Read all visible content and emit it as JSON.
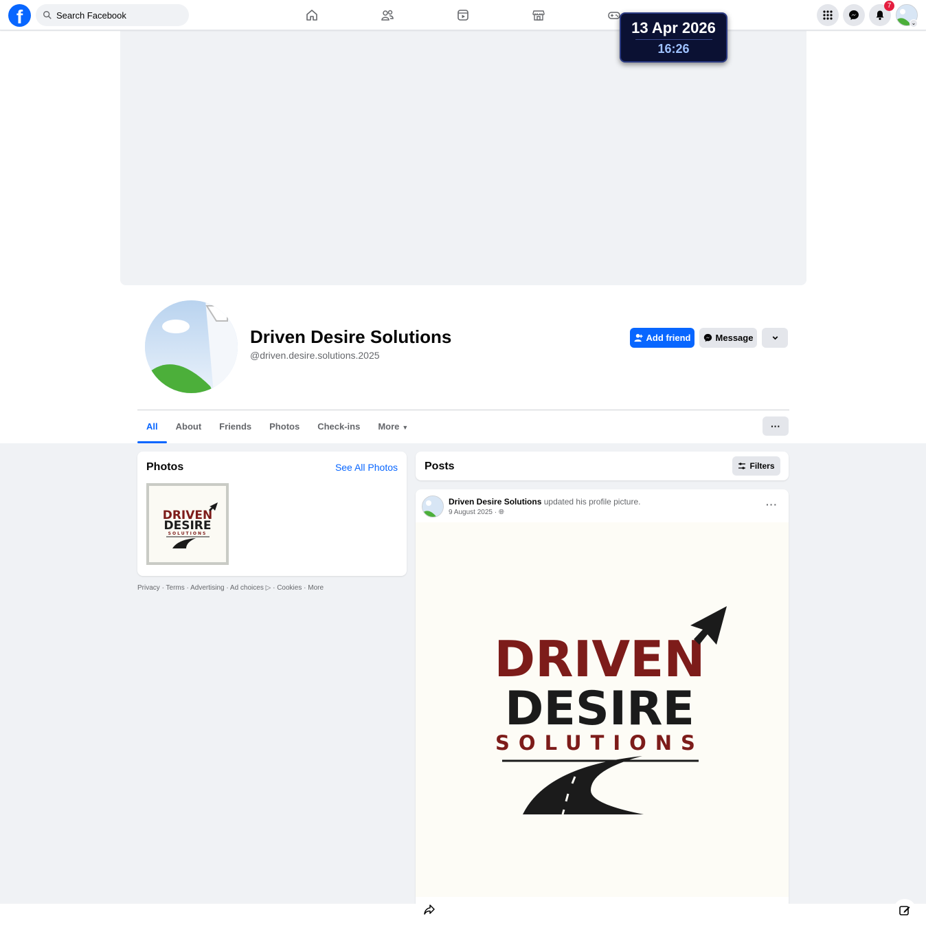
{
  "nav": {
    "search_placeholder": "Search Facebook",
    "notifications_count": "7",
    "brand_color": "#0866ff"
  },
  "overlay": {
    "date": "13 Apr 2026",
    "time": "16:26"
  },
  "profile": {
    "name": "Driven Desire Solutions",
    "handle": "@driven.desire.solutions.2025",
    "add_friend_label": "Add friend",
    "message_label": "Message"
  },
  "tabs": [
    {
      "label": "All",
      "active": true
    },
    {
      "label": "About"
    },
    {
      "label": "Friends"
    },
    {
      "label": "Photos"
    },
    {
      "label": "Check-ins"
    },
    {
      "label": "More"
    }
  ],
  "photos": {
    "title": "Photos",
    "see_all": "See All Photos"
  },
  "footer": {
    "privacy": "Privacy",
    "terms": "Terms",
    "advertising": "Advertising",
    "ad_choices": "Ad choices",
    "cookies": "Cookies",
    "more": "More",
    "sep": " · "
  },
  "posts": {
    "title": "Posts",
    "filters_label": "Filters",
    "items": [
      {
        "author": "Driven Desire Solutions",
        "action": "updated his profile picture.",
        "date": "9 August 2025",
        "logo": {
          "line1": "DRIVEN",
          "line2": "DESIRE",
          "line3": "SOLUTIONS"
        }
      }
    ]
  },
  "thumb_logo": {
    "line1": "DRIVEN",
    "line2": "DESIRE",
    "line3": "SOLUTIONS"
  },
  "colors": {
    "logo_red": "#7d1c1a",
    "logo_black": "#1b1b1b"
  }
}
